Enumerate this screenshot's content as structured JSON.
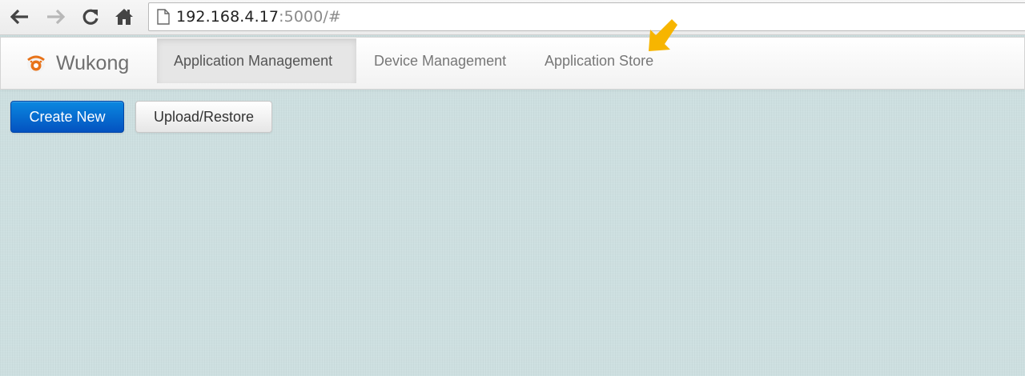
{
  "browser": {
    "url_host": "192.168.4.17",
    "url_path": ":5000/#",
    "icons": [
      "back-arrow-icon",
      "forward-arrow-icon",
      "reload-icon",
      "home-icon",
      "page-icon"
    ]
  },
  "navbar": {
    "brand": "Wukong",
    "items": [
      {
        "label": "Application Management",
        "active": true
      },
      {
        "label": "Device Management",
        "active": false
      },
      {
        "label": "Application Store",
        "active": false
      }
    ]
  },
  "toolbar": {
    "create_label": "Create New",
    "upload_label": "Upload/Restore"
  },
  "colors": {
    "primary": "#0a6fd6",
    "background": "#cddfe0",
    "arrow": "#f7b500"
  }
}
